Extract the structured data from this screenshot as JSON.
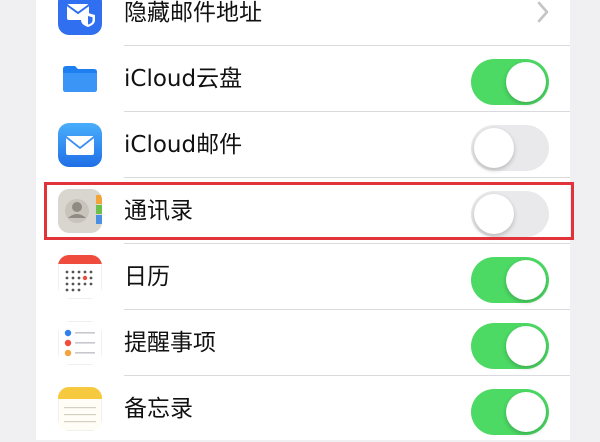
{
  "colors": {
    "toggle_on": "#4cd964",
    "toggle_off": "#e9e9eb",
    "highlight": "#e0333a",
    "accent_blue": "#2f80ed"
  },
  "settings": {
    "items": [
      {
        "label": "隐藏邮件地址",
        "icon": "mail-shield-icon",
        "control": "chevron"
      },
      {
        "label": "iCloud云盘",
        "icon": "folder-icon",
        "control": "toggle",
        "enabled": true
      },
      {
        "label": "iCloud邮件",
        "icon": "mail-icon",
        "control": "toggle",
        "enabled": false
      },
      {
        "label": "通讯录",
        "icon": "contacts-icon",
        "control": "toggle",
        "enabled": false,
        "highlighted": true
      },
      {
        "label": "日历",
        "icon": "calendar-icon",
        "control": "toggle",
        "enabled": true
      },
      {
        "label": "提醒事项",
        "icon": "reminders-icon",
        "control": "toggle",
        "enabled": true
      },
      {
        "label": "备忘录",
        "icon": "notes-icon",
        "control": "toggle",
        "enabled": true
      }
    ]
  }
}
